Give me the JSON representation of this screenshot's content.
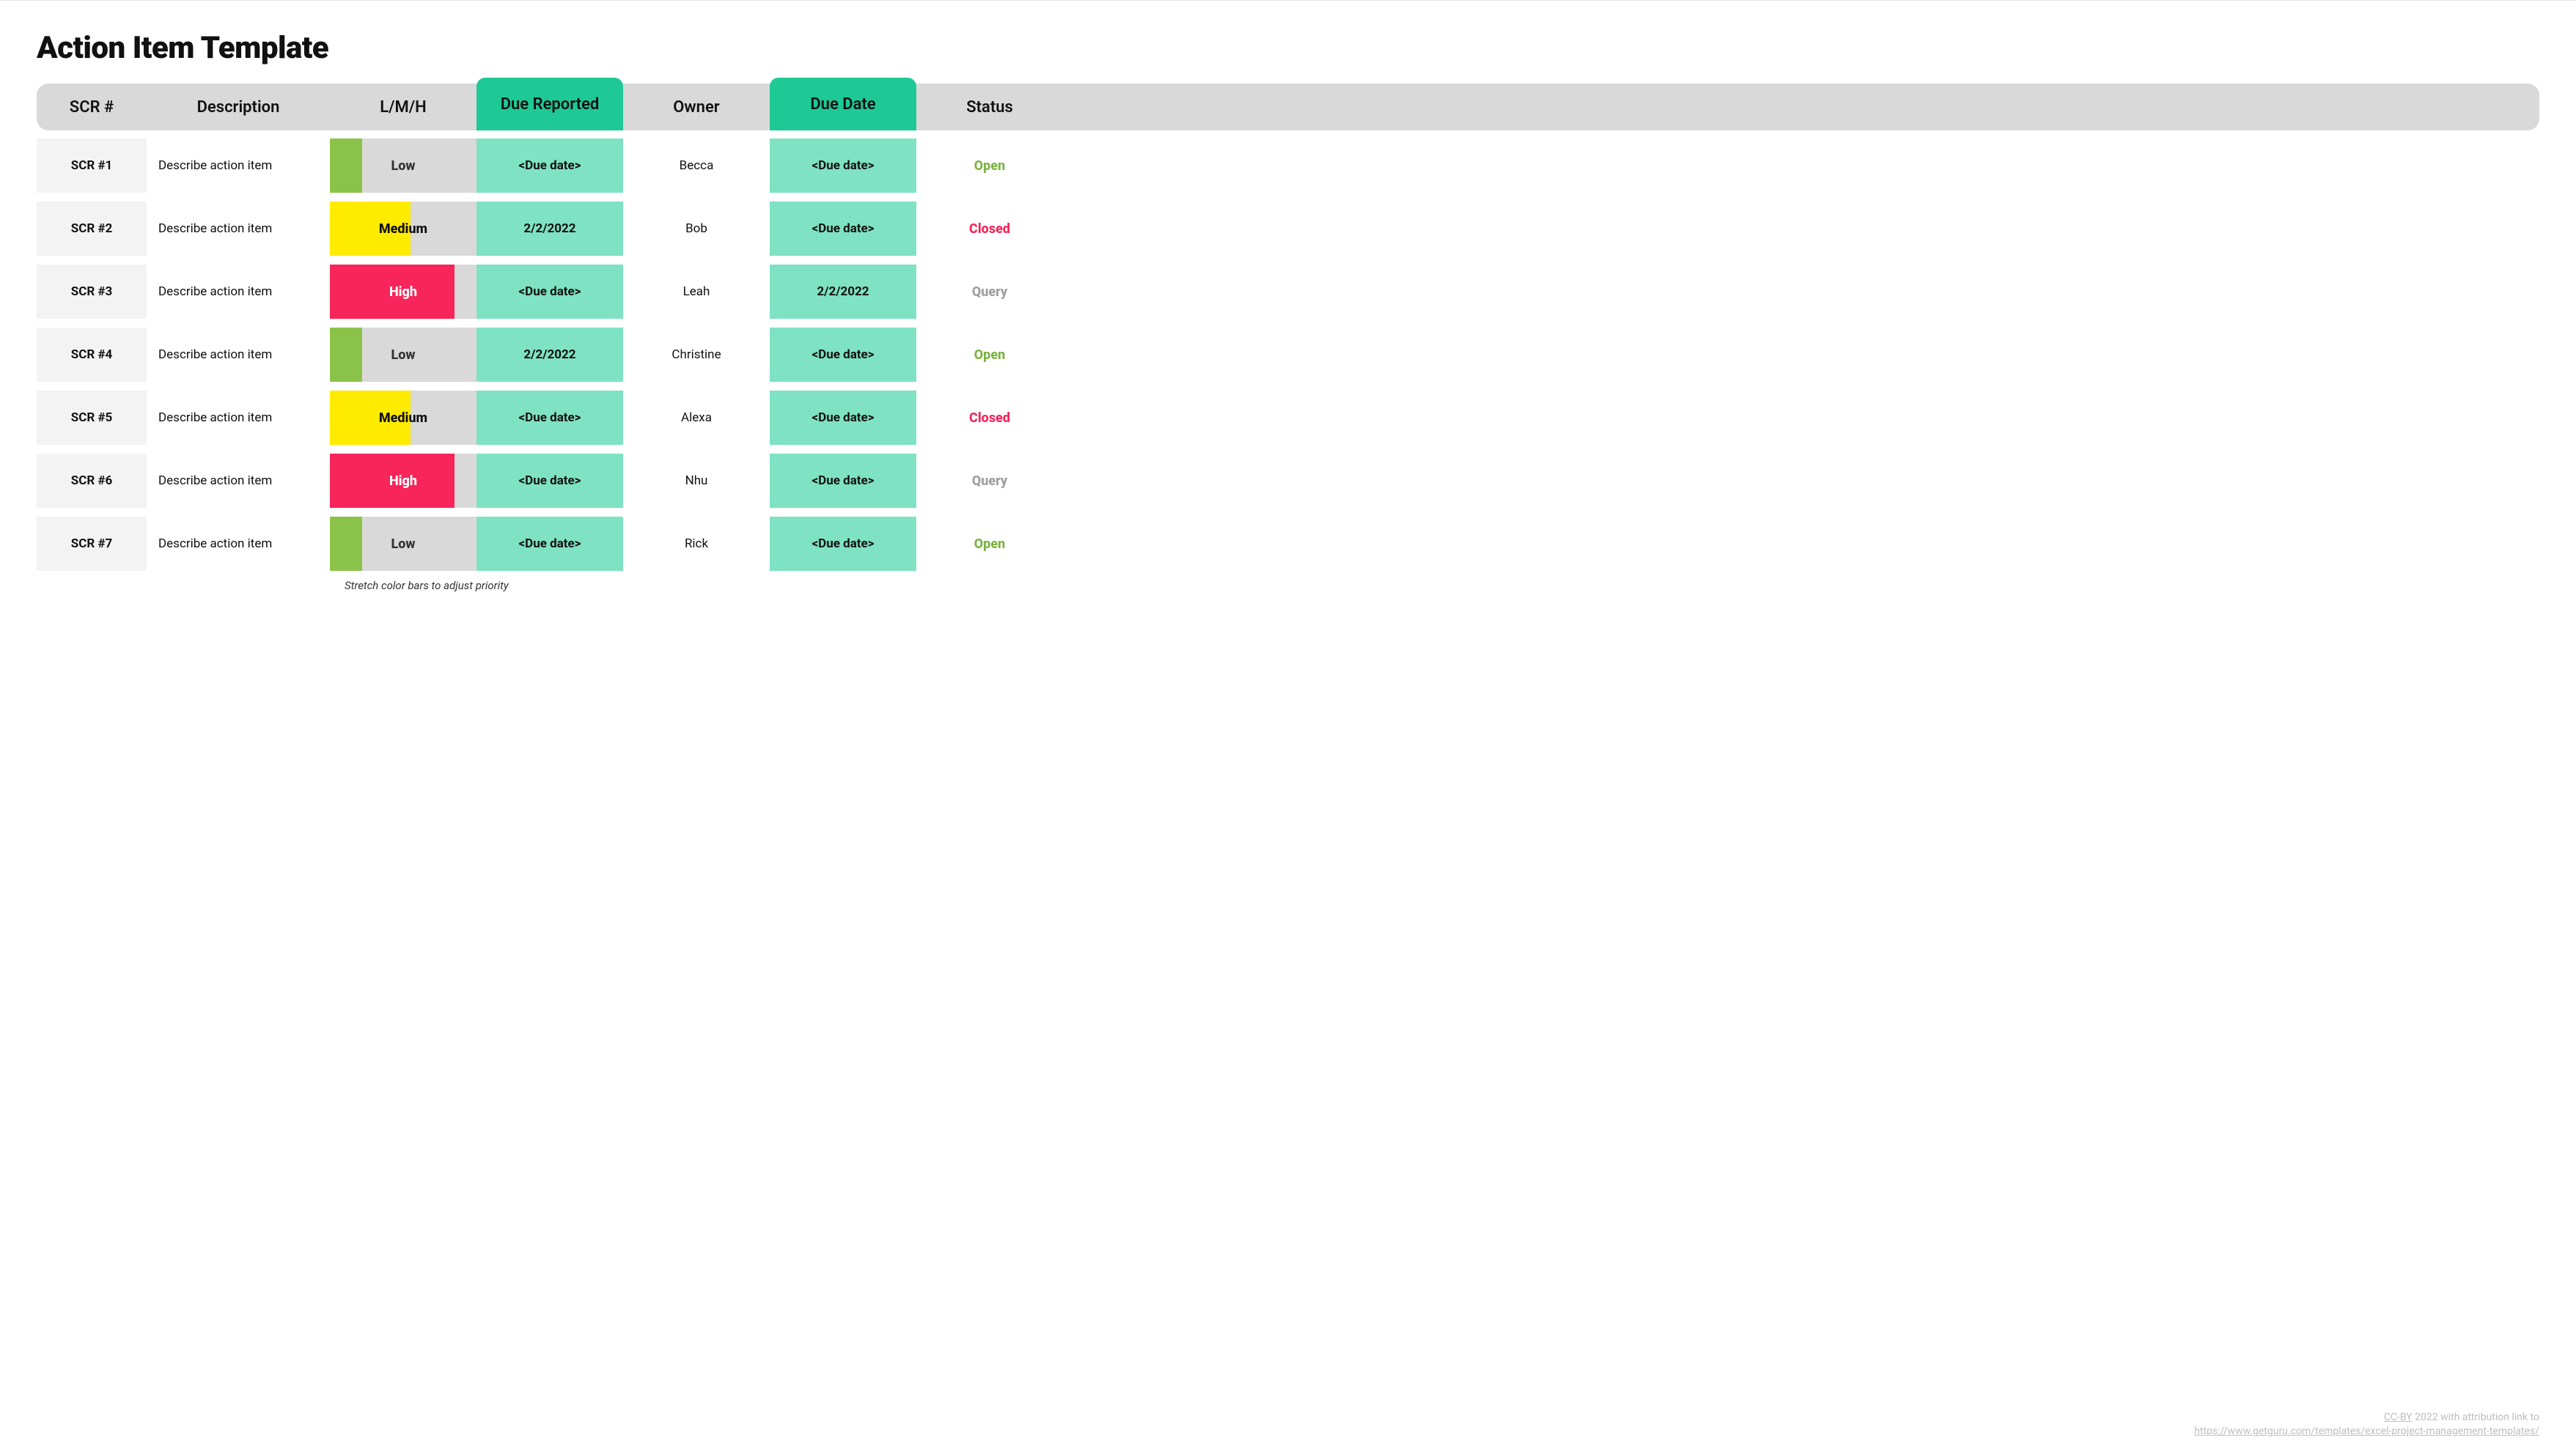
{
  "title": "Action Item Template",
  "columns": {
    "scr": "SCR #",
    "description": "Description",
    "priority": "L/M/H",
    "due_reported": "Due Reported",
    "owner": "Owner",
    "due_date": "Due Date",
    "status": "Status"
  },
  "rows": [
    {
      "scr": "SCR #1",
      "description": "Describe action item",
      "priority_level": "low",
      "priority_label": "Low",
      "due_reported": "<Due date>",
      "owner": "Becca",
      "due_date": "<Due date>",
      "status": "Open",
      "status_class": "status-open"
    },
    {
      "scr": "SCR #2",
      "description": "Describe action item",
      "priority_level": "medium",
      "priority_label": "Medium",
      "due_reported": "2/2/2022",
      "owner": "Bob",
      "due_date": "<Due date>",
      "status": "Closed",
      "status_class": "status-closed"
    },
    {
      "scr": "SCR #3",
      "description": "Describe action item",
      "priority_level": "high",
      "priority_label": "High",
      "due_reported": "<Due date>",
      "owner": "Leah",
      "due_date": "2/2/2022",
      "status": "Query",
      "status_class": "status-query"
    },
    {
      "scr": "SCR #4",
      "description": "Describe action item",
      "priority_level": "low",
      "priority_label": "Low",
      "due_reported": "2/2/2022",
      "owner": "Christine",
      "due_date": "<Due date>",
      "status": "Open",
      "status_class": "status-open"
    },
    {
      "scr": "SCR #5",
      "description": "Describe action item",
      "priority_level": "medium",
      "priority_label": "Medium",
      "due_reported": "<Due date>",
      "owner": "Alexa",
      "due_date": "<Due date>",
      "status": "Closed",
      "status_class": "status-closed"
    },
    {
      "scr": "SCR #6",
      "description": "Describe action item",
      "priority_level": "high",
      "priority_label": "High",
      "due_reported": "<Due date>",
      "owner": "Nhu",
      "due_date": "<Due date>",
      "status": "Query",
      "status_class": "status-query"
    },
    {
      "scr": "SCR #7",
      "description": "Describe action item",
      "priority_level": "low",
      "priority_label": "Low",
      "due_reported": "<Due date>",
      "owner": "Rick",
      "due_date": "<Due date>",
      "status": "Open",
      "status_class": "status-open"
    }
  ],
  "footnote": "Stretch color bars to adjust priority",
  "attribution": {
    "license": "CC-BY",
    "text_line1": " 2022 with attribution link to",
    "link": "https://www.getguru.com/templates/excel-project-management-templates/"
  },
  "colors": {
    "teal_header": "#1EC996",
    "teal_cell": "#7FE2C2",
    "low": "#8BC34A",
    "medium": "#FFEB00",
    "high": "#F72559",
    "grey_header": "#d9d9d9",
    "grey_row": "#f3f3f3"
  }
}
